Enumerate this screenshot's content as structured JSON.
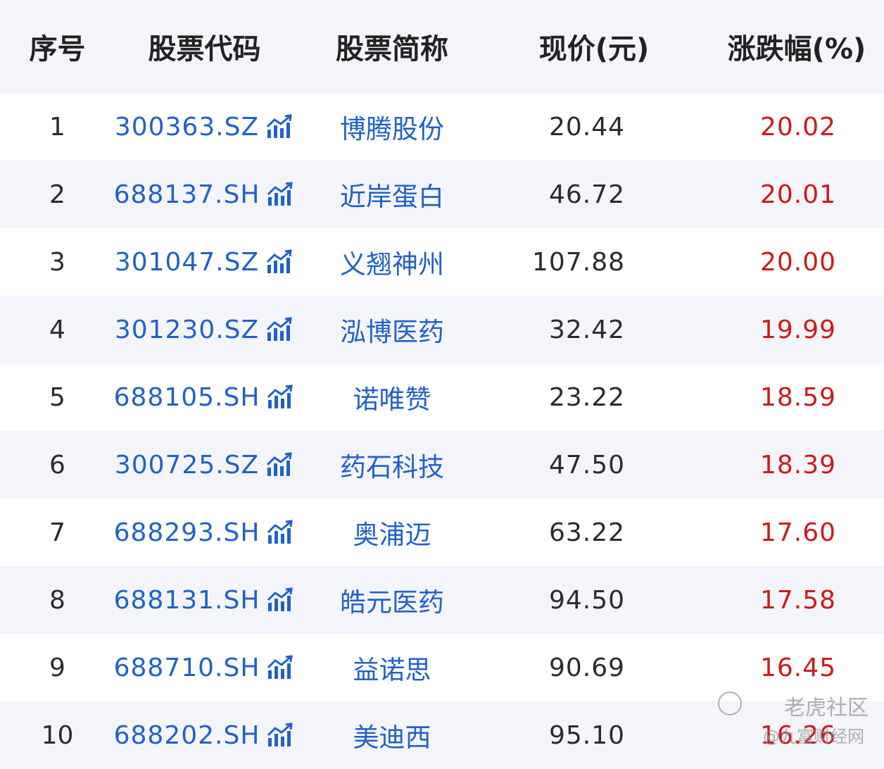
{
  "table": {
    "headers": {
      "index": "序号",
      "code": "股票代码",
      "name": "股票简称",
      "price": "现价(元)",
      "change": "涨跌幅(%)"
    },
    "rows": [
      {
        "index": "1",
        "code": "300363.SZ",
        "name": "博腾股份",
        "price": "20.44",
        "change": "20.02"
      },
      {
        "index": "2",
        "code": "688137.SH",
        "name": "近岸蛋白",
        "price": "46.72",
        "change": "20.01"
      },
      {
        "index": "3",
        "code": "301047.SZ",
        "name": "义翘神州",
        "price": "107.88",
        "change": "20.00"
      },
      {
        "index": "4",
        "code": "301230.SZ",
        "name": "泓博医药",
        "price": "32.42",
        "change": "19.99"
      },
      {
        "index": "5",
        "code": "688105.SH",
        "name": "诺唯赞",
        "price": "23.22",
        "change": "18.59"
      },
      {
        "index": "6",
        "code": "300725.SZ",
        "name": "药石科技",
        "price": "47.50",
        "change": "18.39"
      },
      {
        "index": "7",
        "code": "688293.SH",
        "name": "奥浦迈",
        "price": "63.22",
        "change": "17.60"
      },
      {
        "index": "8",
        "code": "688131.SH",
        "name": "皓元医药",
        "price": "94.50",
        "change": "17.58"
      },
      {
        "index": "9",
        "code": "688710.SH",
        "name": "益诺思",
        "price": "90.69",
        "change": "16.45"
      },
      {
        "index": "10",
        "code": "688202.SH",
        "name": "美迪西",
        "price": "95.10",
        "change": "16.26"
      }
    ]
  },
  "icons": {
    "chart": "trend-chart-icon"
  },
  "colors": {
    "link": "#1f62c8",
    "up": "#cc1a1a",
    "text": "#2b2b2b",
    "shade": "#f4f5fb"
  },
  "watermark": {
    "line1": "老虎社区",
    "line2": "@九富财经网"
  }
}
